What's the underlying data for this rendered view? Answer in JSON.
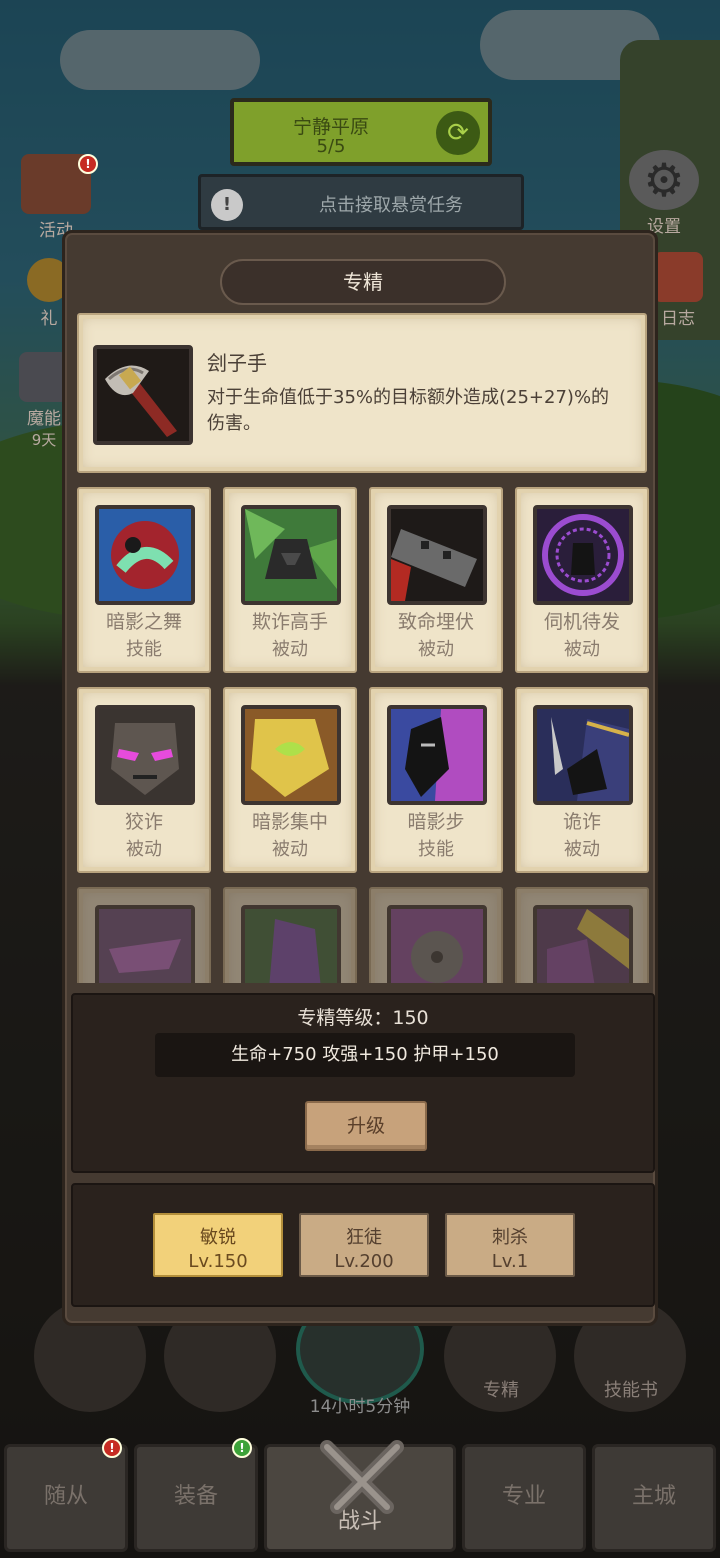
{
  "background": {
    "banner_title": "宁静平原",
    "banner_progress": "5/5",
    "bounty_text": "点击接取悬赏任务",
    "left_buttons": [
      "活动",
      "礼",
      "魔能",
      "9天"
    ],
    "right_buttons": [
      "设置",
      "日志"
    ],
    "timer": "14小时5分钟",
    "bottom_labels": [
      "专精",
      "技能书"
    ],
    "tabs": [
      "随从",
      "装备",
      "战斗",
      "专业",
      "主城"
    ],
    "badge_mark": "!"
  },
  "modal": {
    "title": "专精",
    "selected": {
      "name": "刽子手",
      "description": "对于生命值低于35%的目标额外造成(25+27)%的伤害。"
    },
    "talents": [
      {
        "name": "暗影之舞",
        "type": "技能"
      },
      {
        "name": "欺诈高手",
        "type": "被动"
      },
      {
        "name": "致命埋伏",
        "type": "被动"
      },
      {
        "name": "伺机待发",
        "type": "被动"
      },
      {
        "name": "狡诈",
        "type": "被动"
      },
      {
        "name": "暗影集中",
        "type": "被动"
      },
      {
        "name": "暗影步",
        "type": "技能"
      },
      {
        "name": "诡诈",
        "type": "被动"
      }
    ],
    "level_label": "专精等级：150",
    "stats": "生命+750  攻强+150  护甲+150",
    "upgrade_label": "升级",
    "trees": [
      {
        "name": "敏锐",
        "level": "Lv.150",
        "active": true
      },
      {
        "name": "狂徒",
        "level": "Lv.200",
        "active": false
      },
      {
        "name": "刺杀",
        "level": "Lv.1",
        "active": false
      }
    ]
  }
}
